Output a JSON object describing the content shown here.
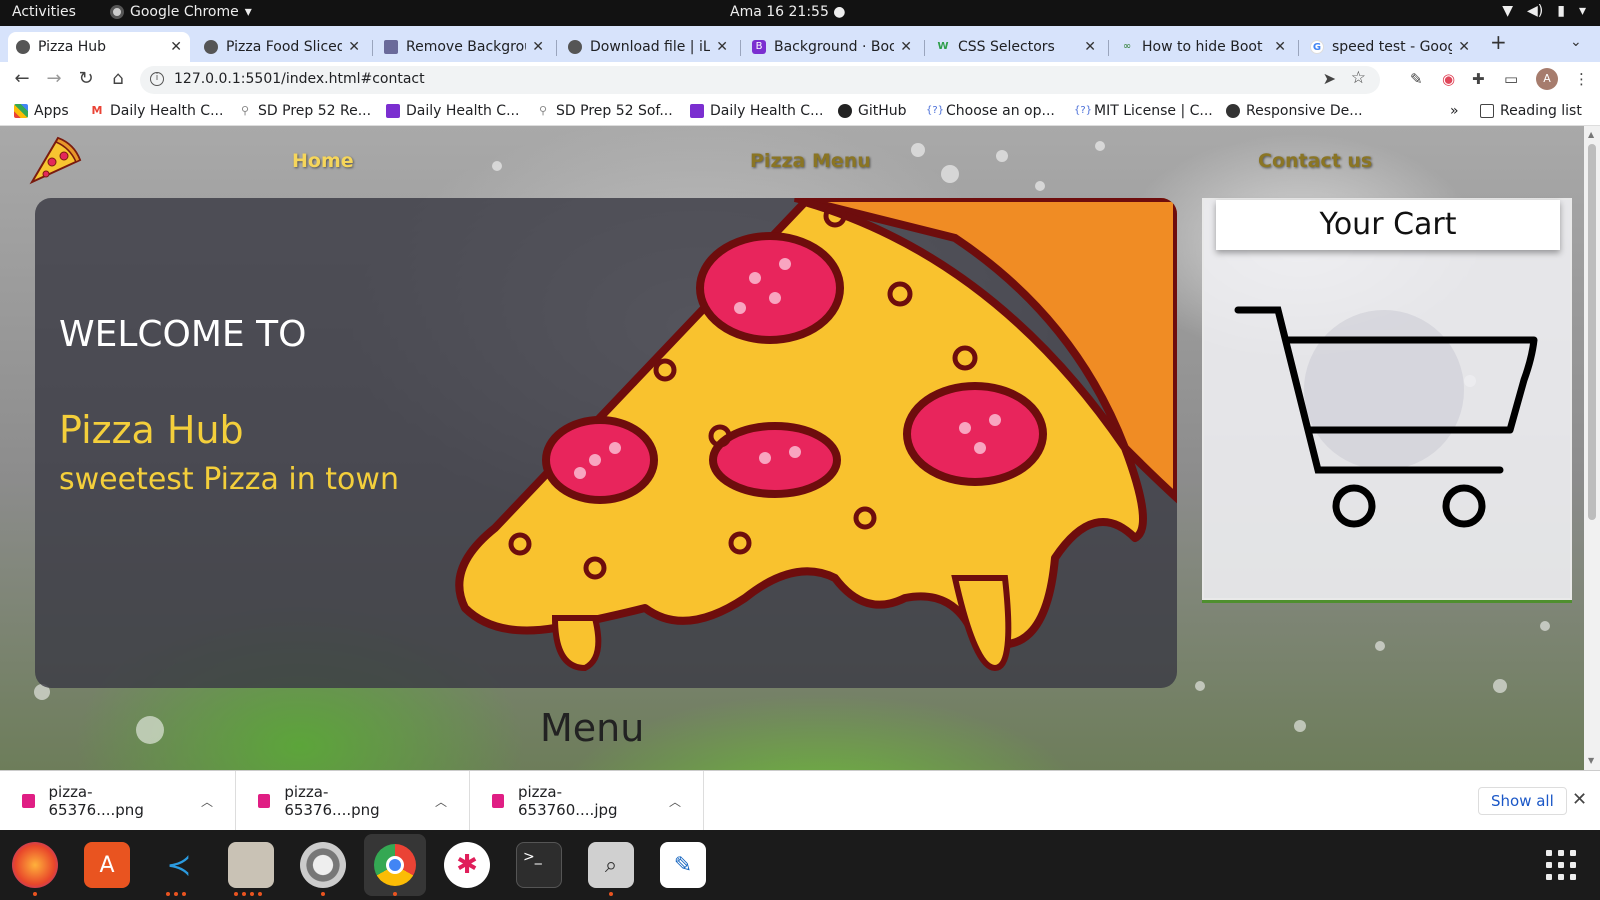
{
  "system": {
    "activities": "Activities",
    "app_name": "Google Chrome",
    "clock": "Ama 16  21:55"
  },
  "tabs": [
    {
      "title": "Pizza Hub",
      "active": true
    },
    {
      "title": "Pizza Food Sliced"
    },
    {
      "title": "Remove Backgrou"
    },
    {
      "title": "Download file | iL"
    },
    {
      "title": "Background · Boo"
    },
    {
      "title": "CSS Selectors"
    },
    {
      "title": "How to hide Boot"
    },
    {
      "title": "speed test - Goog"
    }
  ],
  "address": {
    "url": "127.0.0.1:5501/index.html#contact"
  },
  "bookmarks": [
    {
      "label": "Apps"
    },
    {
      "label": "Daily Health C..."
    },
    {
      "label": "SD Prep 52 Re..."
    },
    {
      "label": "Daily Health C..."
    },
    {
      "label": "SD Prep 52 Sof..."
    },
    {
      "label": "Daily Health C..."
    },
    {
      "label": "GitHub"
    },
    {
      "label": "Choose an op..."
    },
    {
      "label": "MIT License | C..."
    },
    {
      "label": "Responsive De..."
    },
    {
      "label": "Reading list"
    }
  ],
  "page": {
    "nav": {
      "home": "Home",
      "menu": "Pizza Menu",
      "contact": "Contact us"
    },
    "hero": {
      "welcome": "WELCOME TO",
      "brand": "Pizza Hub",
      "tagline": "sweetest Pizza in town"
    },
    "cart": {
      "title": "Your Cart"
    },
    "menu_heading": "Menu"
  },
  "downloads": {
    "items": [
      {
        "name": "pizza-65376....png"
      },
      {
        "name": "pizza-65376....png"
      },
      {
        "name": "pizza-653760....jpg"
      }
    ],
    "show_all": "Show all"
  },
  "avatar_letter": "A",
  "colors": {
    "accent_yellow": "#f4cf3b",
    "nav_active": "#f6d65b",
    "nav_inactive": "#8a7524",
    "chrome_tabstrip": "#d7e3fb"
  }
}
